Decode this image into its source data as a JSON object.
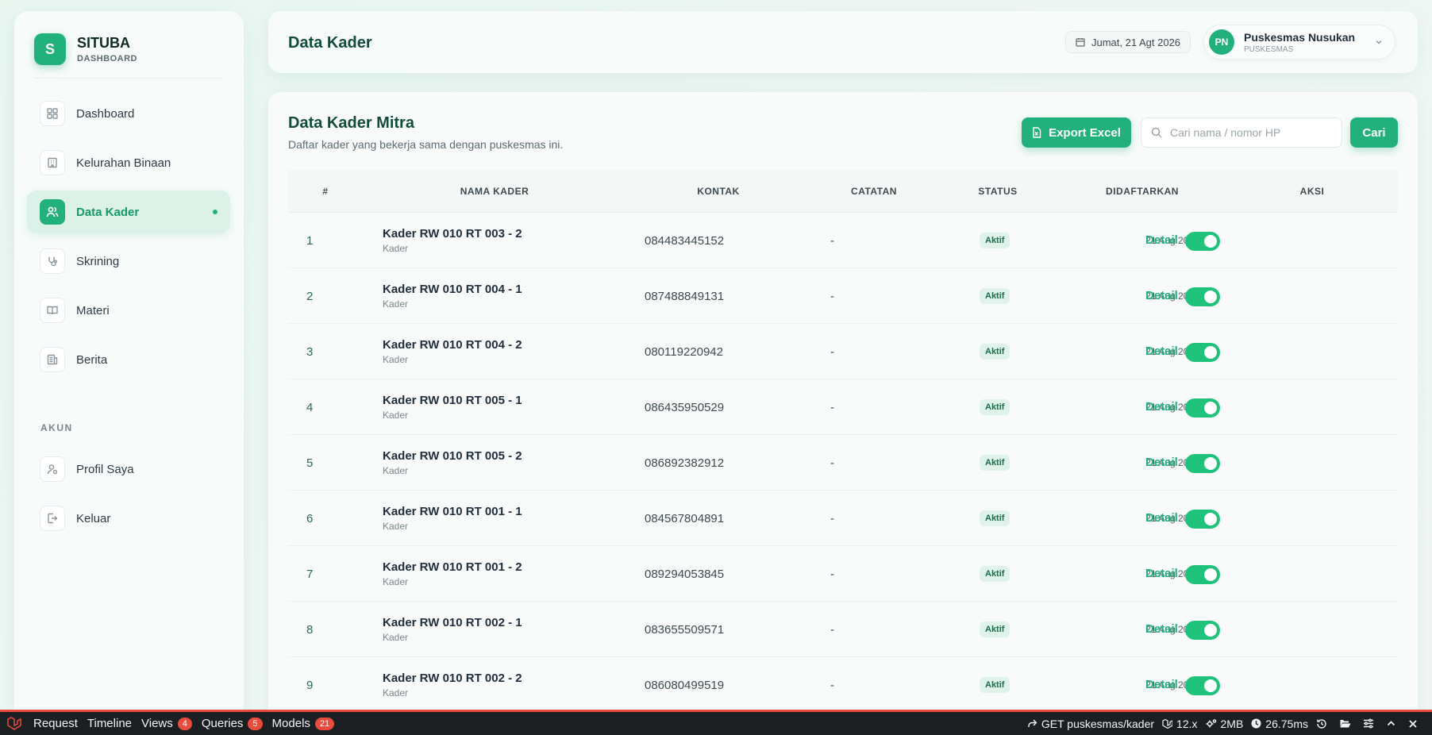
{
  "app": {
    "name": "SITUBA",
    "subtitle": "DASHBOARD",
    "logo_letter": "S"
  },
  "sidebar": {
    "items": [
      {
        "label": "Dashboard",
        "icon": "grid-icon",
        "active": false
      },
      {
        "label": "Kelurahan Binaan",
        "icon": "building-icon",
        "active": false
      },
      {
        "label": "Data Kader",
        "icon": "users-icon",
        "active": true
      },
      {
        "label": "Skrining",
        "icon": "stethoscope-icon",
        "active": false
      },
      {
        "label": "Materi",
        "icon": "book-icon",
        "active": false
      },
      {
        "label": "Berita",
        "icon": "newspaper-icon",
        "active": false
      }
    ],
    "section_label": "AKUN",
    "account_items": [
      {
        "label": "Profil Saya",
        "icon": "user-icon"
      },
      {
        "label": "Keluar",
        "icon": "logout-icon"
      }
    ]
  },
  "header": {
    "title": "Data Kader",
    "date": "Jumat, 21 Agt 2026",
    "user": {
      "initials": "PN",
      "name": "Puskesmas Nusukan",
      "role": "PUSKESMAS"
    }
  },
  "main": {
    "title": "Data Kader Mitra",
    "subtitle": "Daftar kader yang bekerja sama dengan puskesmas ini.",
    "export_label": "Export Excel",
    "search_placeholder": "Cari nama / nomor HP",
    "search_value": "",
    "search_button": "Cari",
    "columns": [
      "#",
      "NAMA KADER",
      "KONTAK",
      "CATATAN",
      "STATUS",
      "DIDAFTARKAN",
      "AKSI"
    ],
    "detail_label": "Detail",
    "rows": [
      {
        "no": "1",
        "name": "Kader RW 010 RT 003 - 2",
        "role": "Kader",
        "phone": "084483445152",
        "note": "-",
        "status": "Aktif",
        "date": "21 Aug 2026",
        "enabled": true
      },
      {
        "no": "2",
        "name": "Kader RW 010 RT 004 - 1",
        "role": "Kader",
        "phone": "087488849131",
        "note": "-",
        "status": "Aktif",
        "date": "21 Aug 2026",
        "enabled": true
      },
      {
        "no": "3",
        "name": "Kader RW 010 RT 004 - 2",
        "role": "Kader",
        "phone": "080119220942",
        "note": "-",
        "status": "Aktif",
        "date": "21 Aug 2026",
        "enabled": true
      },
      {
        "no": "4",
        "name": "Kader RW 010 RT 005 - 1",
        "role": "Kader",
        "phone": "086435950529",
        "note": "-",
        "status": "Aktif",
        "date": "21 Aug 2026",
        "enabled": true
      },
      {
        "no": "5",
        "name": "Kader RW 010 RT 005 - 2",
        "role": "Kader",
        "phone": "086892382912",
        "note": "-",
        "status": "Aktif",
        "date": "21 Aug 2026",
        "enabled": true
      },
      {
        "no": "6",
        "name": "Kader RW 010 RT 001 - 1",
        "role": "Kader",
        "phone": "084567804891",
        "note": "-",
        "status": "Aktif",
        "date": "21 Aug 2026",
        "enabled": true
      },
      {
        "no": "7",
        "name": "Kader RW 010 RT 001 - 2",
        "role": "Kader",
        "phone": "089294053845",
        "note": "-",
        "status": "Aktif",
        "date": "21 Aug 2026",
        "enabled": true
      },
      {
        "no": "8",
        "name": "Kader RW 010 RT 002 - 1",
        "role": "Kader",
        "phone": "083655509571",
        "note": "-",
        "status": "Aktif",
        "date": "21 Aug 2026",
        "enabled": true
      },
      {
        "no": "9",
        "name": "Kader RW 010 RT 002 - 2",
        "role": "Kader",
        "phone": "086080499519",
        "note": "-",
        "status": "Aktif",
        "date": "21 Aug 2026",
        "enabled": true
      }
    ]
  },
  "debugbar": {
    "left": [
      {
        "label": "Request"
      },
      {
        "label": "Timeline"
      },
      {
        "label": "Views",
        "count": "4"
      },
      {
        "label": "Queries",
        "count": "5"
      },
      {
        "label": "Models",
        "count": "21"
      }
    ],
    "route": "GET puskesmas/kader",
    "version": "12.x",
    "memory": "2MB",
    "time": "26.75ms"
  },
  "colors": {
    "accent": "#22b07d",
    "title": "#124c3b",
    "debug_red": "#e74c3c"
  }
}
